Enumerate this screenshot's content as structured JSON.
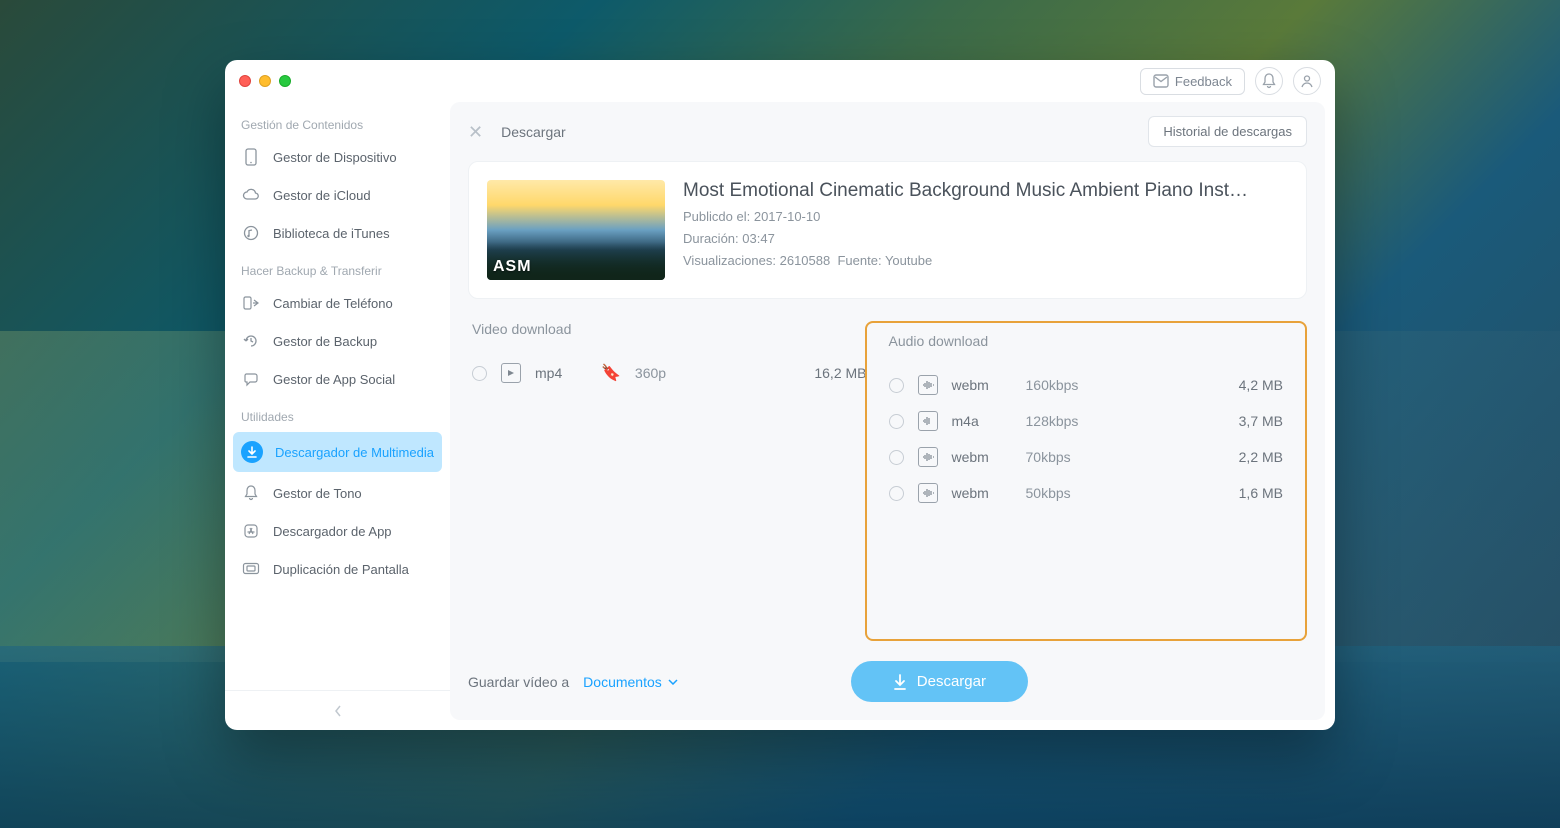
{
  "titlebar": {
    "feedback": "Feedback"
  },
  "sidebar": {
    "sections": {
      "content": "Gestión de Contenidos",
      "backup": "Hacer Backup & Transferir",
      "utilities": "Utilidades"
    },
    "items": {
      "device": "Gestor de Dispositivo",
      "icloud": "Gestor de iCloud",
      "itunes": "Biblioteca de iTunes",
      "switch": "Cambiar de Teléfono",
      "backup_mgr": "Gestor de Backup",
      "social": "Gestor de App Social",
      "media_dl": "Descargador de Multimedia",
      "tone": "Gestor de Tono",
      "app_dl": "Descargador de App",
      "screen": "Duplicación de Pantalla"
    }
  },
  "main": {
    "title": "Descargar",
    "history": "Historial de descargas"
  },
  "video": {
    "thumb_label": "ASM",
    "title": "Most Emotional Cinematic Background Music   Ambient Piano Inst…",
    "published_label": "Publicdo el:",
    "published": "2017-10-10",
    "duration_label": "Duración:",
    "duration": "03:47",
    "views_label": "Visualizaciones:",
    "views": "2610588",
    "source_label": "Fuente:",
    "source": "Youtube"
  },
  "downloads": {
    "video_heading": "Video download",
    "audio_heading": "Audio download",
    "video": [
      {
        "fmt": "mp4",
        "quality": "360p",
        "size": "16,2 MB",
        "bookmarked": true
      }
    ],
    "audio": [
      {
        "fmt": "webm",
        "quality": "160kbps",
        "size": "4,2 MB"
      },
      {
        "fmt": "m4a",
        "quality": "128kbps",
        "size": "3,7 MB"
      },
      {
        "fmt": "webm",
        "quality": "70kbps",
        "size": "2,2 MB"
      },
      {
        "fmt": "webm",
        "quality": "50kbps",
        "size": "1,6 MB"
      }
    ]
  },
  "footer": {
    "save_label": "Guardar vídeo a",
    "destination": "Documentos",
    "download": "Descargar"
  }
}
